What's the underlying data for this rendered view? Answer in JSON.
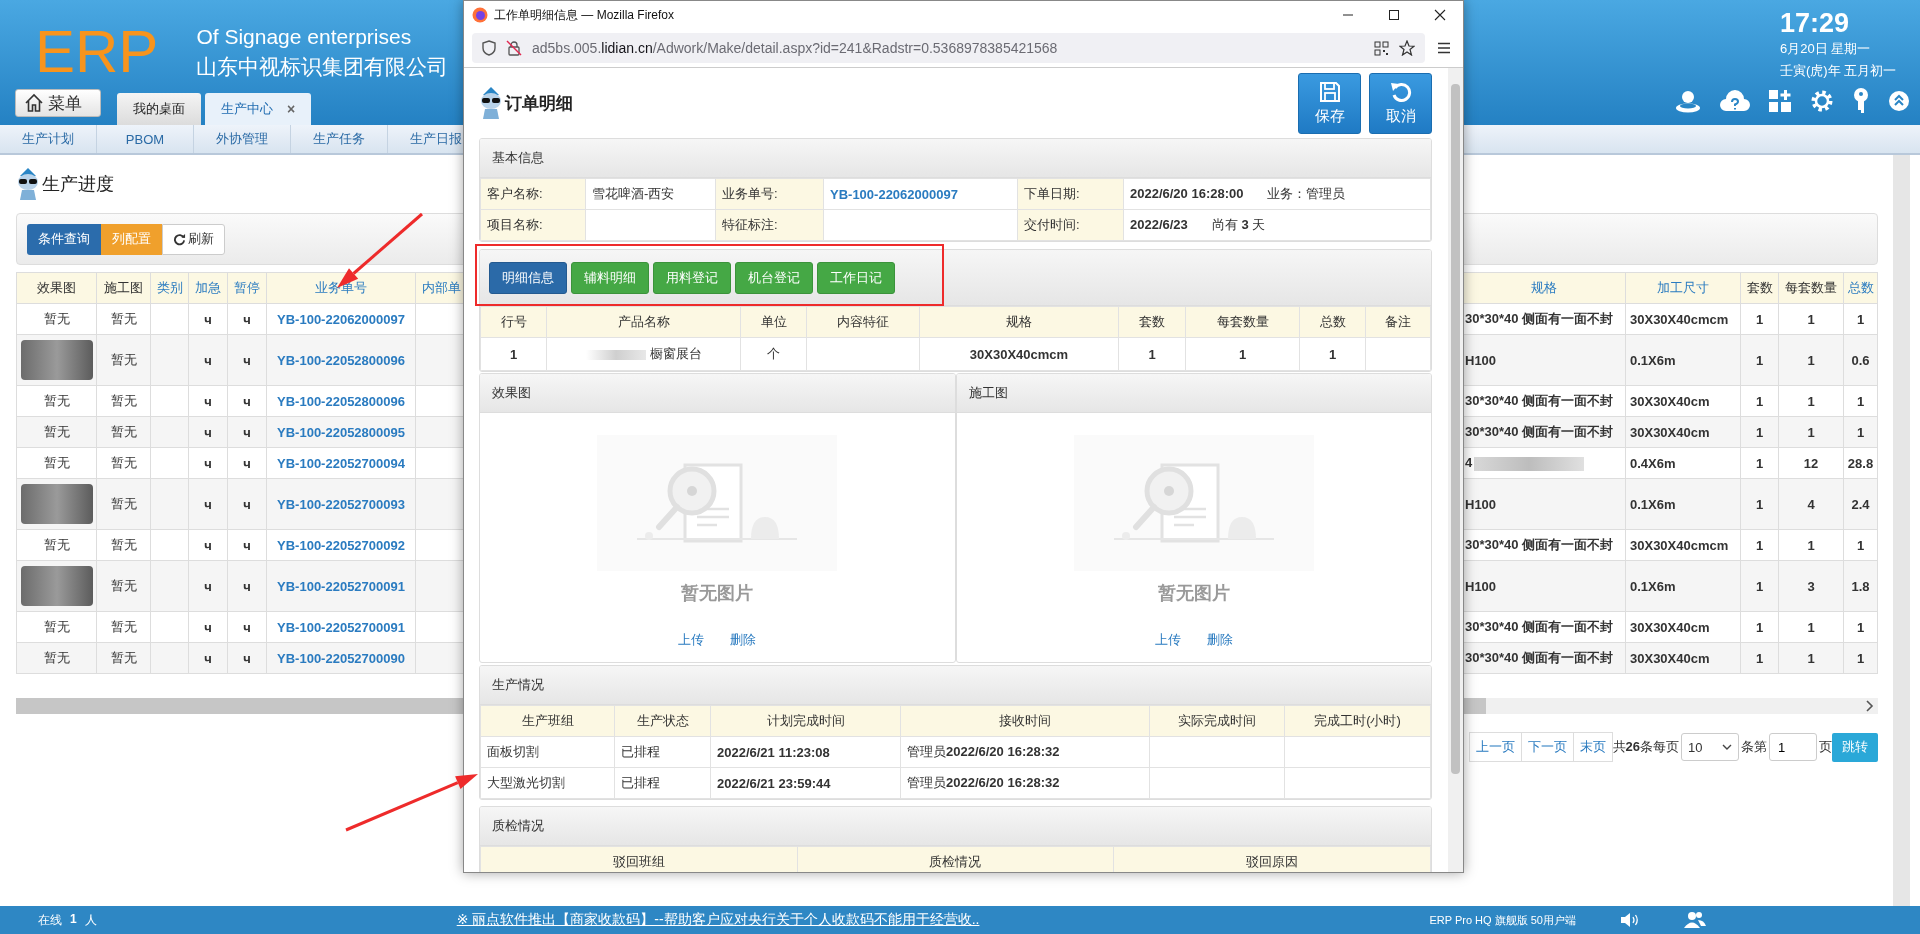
{
  "header": {
    "logo": "ERP",
    "slogan": "Of Signage enterprises",
    "company": "山东中视标识集团有限公司",
    "menu_button": "菜单",
    "tabs": [
      {
        "label": "我的桌面",
        "selected": false,
        "closable": false
      },
      {
        "label": "生产中心",
        "selected": true,
        "closable": true,
        "close": "×"
      }
    ],
    "clock": {
      "time": "17:29",
      "date": "6月20日 星期一",
      "lunar": "壬寅(虎)年 五月初一"
    }
  },
  "nav": [
    "生产计划",
    "PBOM",
    "外协管理",
    "生产任务",
    "生产日报"
  ],
  "page": {
    "title": "生产进度",
    "toolbar": [
      {
        "label": "条件查询",
        "kind": "primary"
      },
      {
        "label": "列配置",
        "kind": "warning"
      },
      {
        "label": "刷新",
        "kind": "refresh"
      }
    ]
  },
  "table": {
    "columns": [
      {
        "label": "效果图",
        "sortable": false
      },
      {
        "label": "施工图",
        "sortable": false
      },
      {
        "label": "类别",
        "sortable": true
      },
      {
        "label": "加急",
        "sortable": true
      },
      {
        "label": "暂停",
        "sortable": true
      },
      {
        "label": "业务单号",
        "sortable": true
      },
      {
        "label": "内部单",
        "sortable": true
      },
      {
        "label": "规格",
        "sortable": true
      },
      {
        "label": "加工尺寸",
        "sortable": true
      },
      {
        "label": "套数",
        "sortable": false
      },
      {
        "label": "每套数量",
        "sortable": false
      },
      {
        "label": "总数",
        "sortable": true
      }
    ],
    "rows": [
      {
        "effect": {
          "kind": "text",
          "text": "暂无"
        },
        "drawing": "暂无",
        "urgent": "ч",
        "pause": "ч",
        "order": "YB-100-22062000097",
        "spec": "30*30*40 侧面有一面不封",
        "spec_redacted": false,
        "size": "30X30X40cmcm",
        "sets": "1",
        "per_set": "1",
        "total": "1"
      },
      {
        "effect": {
          "kind": "photo"
        },
        "drawing": "暂无",
        "urgent": "ч",
        "pause": "ч",
        "order": "YB-100-22052800096",
        "spec": "H100",
        "spec_redacted": false,
        "size": "0.1X6m",
        "sets": "1",
        "per_set": "1",
        "total": "0.6"
      },
      {
        "effect": {
          "kind": "text",
          "text": "暂无"
        },
        "drawing": "暂无",
        "urgent": "ч",
        "pause": "ч",
        "order": "YB-100-22052800096",
        "spec": "30*30*40 侧面有一面不封",
        "spec_redacted": false,
        "size": "30X30X40cm",
        "sets": "1",
        "per_set": "1",
        "total": "1"
      },
      {
        "effect": {
          "kind": "text",
          "text": "暂无"
        },
        "drawing": "暂无",
        "urgent": "ч",
        "pause": "ч",
        "order": "YB-100-22052800095",
        "spec": "30*30*40 侧面有一面不封",
        "spec_redacted": false,
        "size": "30X30X40cm",
        "sets": "1",
        "per_set": "1",
        "total": "1"
      },
      {
        "effect": {
          "kind": "text",
          "text": "暂无"
        },
        "drawing": "暂无",
        "urgent": "ч",
        "pause": "ч",
        "order": "YB-100-22052700094",
        "spec": "4",
        "spec_redacted": true,
        "size": "0.4X6m",
        "sets": "1",
        "per_set": "12",
        "total": "28.8"
      },
      {
        "effect": {
          "kind": "photo"
        },
        "drawing": "暂无",
        "urgent": "ч",
        "pause": "ч",
        "order": "YB-100-22052700093",
        "spec": "H100",
        "spec_redacted": false,
        "size": "0.1X6m",
        "sets": "1",
        "per_set": "4",
        "total": "2.4"
      },
      {
        "effect": {
          "kind": "text",
          "text": "暂无"
        },
        "drawing": "暂无",
        "urgent": "ч",
        "pause": "ч",
        "order": "YB-100-22052700092",
        "spec": "30*30*40 侧面有一面不封",
        "spec_redacted": false,
        "size": "30X30X40cmcm",
        "sets": "1",
        "per_set": "1",
        "total": "1"
      },
      {
        "effect": {
          "kind": "photo"
        },
        "drawing": "暂无",
        "urgent": "ч",
        "pause": "ч",
        "order": "YB-100-22052700091",
        "spec": "H100",
        "spec_redacted": false,
        "size": "0.1X6m",
        "sets": "1",
        "per_set": "3",
        "total": "1.8"
      },
      {
        "effect": {
          "kind": "text",
          "text": "暂无"
        },
        "drawing": "暂无",
        "urgent": "ч",
        "pause": "ч",
        "order": "YB-100-22052700091",
        "spec": "30*30*40 侧面有一面不封",
        "spec_redacted": false,
        "size": "30X30X40cm",
        "sets": "1",
        "per_set": "1",
        "total": "1"
      },
      {
        "effect": {
          "kind": "text",
          "text": "暂无"
        },
        "drawing": "暂无",
        "urgent": "ч",
        "pause": "ч",
        "order": "YB-100-22052700090",
        "spec": "30*30*40 侧面有一面不封",
        "spec_redacted": false,
        "size": "30X30X40cm",
        "sets": "1",
        "per_set": "1",
        "total": "1"
      }
    ]
  },
  "pagination": {
    "prev": "上一页",
    "next": "下一页",
    "last": "末页",
    "summary": "共**26**条每页",
    "page_size": "10",
    "page_label": "条第",
    "page_value": "1",
    "page_unit": "页",
    "go": "跳转"
  },
  "popup": {
    "window_title": "工作单明细信息 — Mozilla Firefox",
    "url": {
      "prefix": "ad5bs.005.",
      "domain": "lidian.cn",
      "path": "/Adwork/Make/detail.aspx?id=241&Radstr=0.5368978385421568"
    },
    "title": "订单明细",
    "actions": [
      {
        "label": "保存",
        "kind": "save"
      },
      {
        "label": "取消",
        "kind": "undo"
      }
    ],
    "basic_info": {
      "title": "基本信息",
      "rows": [
        {
          "cells": [
            {
              "kind": "label",
              "text": "客户名称:"
            },
            {
              "kind": "value",
              "text": "雪花啤酒-西安"
            },
            {
              "kind": "label",
              "text": "业务单号:"
            },
            {
              "kind": "link",
              "text": "YB-100-22062000097"
            },
            {
              "kind": "label",
              "text": "下单日期:"
            },
            {
              "kind": "bold",
              "text": "2022/6/20 16:28:00",
              "extra": "业务：管理员"
            }
          ]
        },
        {
          "cells": [
            {
              "kind": "label",
              "text": "项目名称:"
            },
            {
              "kind": "value"
            },
            {
              "kind": "label",
              "text": "特征标注:"
            },
            {
              "kind": "value"
            },
            {
              "kind": "label",
              "text": "交付时间:"
            },
            {
              "kind": "bold",
              "text": "2022/6/23",
              "extra": "尚有 **3** 天"
            }
          ]
        }
      ]
    },
    "tabs": [
      {
        "label": "明细信息",
        "selected": true
      },
      {
        "label": "辅料明细",
        "selected": false
      },
      {
        "label": "用料登记",
        "selected": false
      },
      {
        "label": "机台登记",
        "selected": false
      },
      {
        "label": "工作日记",
        "selected": false
      }
    ],
    "detail_table": {
      "columns": [
        "行号",
        "产品名称",
        "单位",
        "内容特征",
        "规格",
        "套数",
        "每套数量",
        "总数",
        "备注"
      ],
      "rows": [
        {
          "no": "1",
          "product": "橱窗展台",
          "product_redacted": true,
          "unit": "个",
          "spec": "30X30X40cmcm",
          "sets": "1",
          "per_set": "1",
          "total": "1"
        }
      ]
    },
    "images": [
      {
        "title": "效果图",
        "empty_text": "暂无图片",
        "links": [
          "上传",
          "删除"
        ]
      },
      {
        "title": "施工图",
        "empty_text": "暂无图片",
        "links": [
          "上传",
          "删除"
        ]
      }
    ],
    "production": {
      "title": "生产情况",
      "columns": [
        "生产班组",
        "生产状态",
        "计划完成时间",
        "接收时间",
        "实际完成时间",
        "完成工时(小时)"
      ],
      "rows": [
        {
          "team": "面板切割",
          "status": "已排程",
          "planned": "2022/6/21 11:23:08",
          "received": "管理员**2022/6/20 16:28:32**"
        },
        {
          "team": "大型激光切割",
          "status": "已排程",
          "planned": "2022/6/21 23:59:44",
          "received": "管理员**2022/6/20 16:28:32**"
        }
      ]
    },
    "qc": {
      "title": "质检情况",
      "columns": [
        "驳回班组",
        "质检情况",
        "驳回原因"
      ]
    }
  },
  "status_bar": {
    "online_label": "在线",
    "online_count": "1",
    "online_unit": "人",
    "notice": "※ 丽点软件推出【商家收款码】--帮助客户应对央行关于个人收款码不能用于经营收..",
    "edition": "ERP Pro HQ 旗舰版 50用户端"
  }
}
